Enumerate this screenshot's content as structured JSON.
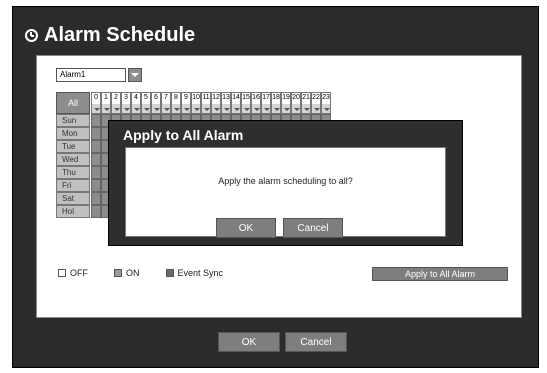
{
  "window": {
    "title": "Alarm Schedule"
  },
  "selector": {
    "value": "Alarm1"
  },
  "grid": {
    "all_label": "All",
    "hours": [
      "0",
      "1",
      "2",
      "3",
      "4",
      "5",
      "6",
      "7",
      "8",
      "9",
      "10",
      "11",
      "12",
      "13",
      "14",
      "15",
      "16",
      "17",
      "18",
      "19",
      "20",
      "21",
      "22",
      "23"
    ],
    "days": [
      "Sun",
      "Mon",
      "Tue",
      "Wed",
      "Thu",
      "Fri",
      "Sat",
      "Hol"
    ]
  },
  "legend": {
    "off": "OFF",
    "on": "ON",
    "event_sync": "Event Sync"
  },
  "colors": {
    "off": "#ffffff",
    "on": "#9a9a9a",
    "event_sync": "#6a6a6a"
  },
  "apply_all_button": "Apply to All Alarm",
  "footer": {
    "ok": "OK",
    "cancel": "Cancel"
  },
  "dialog": {
    "title": "Apply to All Alarm",
    "message": "Apply the alarm scheduling to all?",
    "ok": "OK",
    "cancel": "Cancel"
  }
}
